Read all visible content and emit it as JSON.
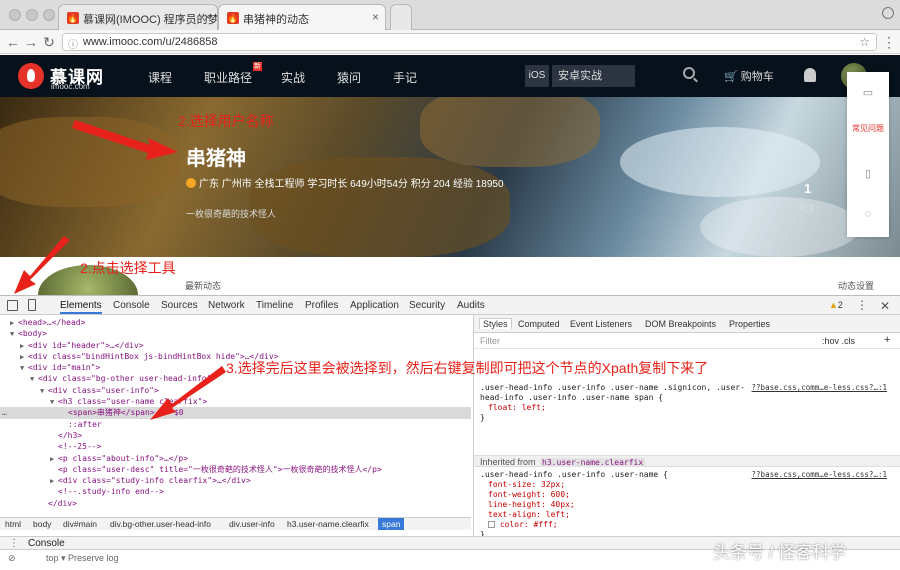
{
  "browser": {
    "tabs": [
      {
        "label": "慕课网(IMOOC) 程序员的梦工厂",
        "active": false
      },
      {
        "label": "串猪神的动态",
        "active": true
      }
    ],
    "url": "www.imooc.com/u/2486858"
  },
  "site_nav": {
    "logo_text": "慕课网",
    "logo_sub": "imooc.com",
    "links": [
      "课程",
      "职业路径",
      "实战",
      "猿问",
      "手记"
    ],
    "new_badge": "新",
    "search_tag": "iOS",
    "search_placeholder": "安卓实战",
    "cart_label": "购物车"
  },
  "profile": {
    "username": "串猪神",
    "meta": "广东 广州市 全栈工程师   学习时长 649小时54分   积分 204   经验 18950",
    "signature": "一枚很奇葩的技术怪人",
    "follow_count": "1",
    "follow_label": "关注",
    "recent_label": "最新动态",
    "settings_label": "动态设置"
  },
  "side_rail": {
    "items": [
      "常见问题"
    ]
  },
  "annotations": {
    "step2_name": "2.选择用户名称",
    "step2_tool": "2.点击选择工具",
    "step3": "3.选择完后这里会被选择到，然后右键复制即可把这个节点的Xpath复制下来了"
  },
  "devtools": {
    "tabs": [
      "Elements",
      "Console",
      "Sources",
      "Network",
      "Timeline",
      "Profiles",
      "Application",
      "Security",
      "Audits"
    ],
    "warnings": "2",
    "dom_lines": [
      {
        "indent": 0,
        "tri": "▶",
        "text": "<head>…</head>"
      },
      {
        "indent": 0,
        "tri": "▼",
        "text": "<body>"
      },
      {
        "indent": 1,
        "tri": "▶",
        "text": "<div id=\"header\">…</div>"
      },
      {
        "indent": 1,
        "tri": "▶",
        "text": "<div class=\"bindHintBox js-bindHintBox hide\">…</div>"
      },
      {
        "indent": 1,
        "tri": "▼",
        "text": "<div id=\"main\">"
      },
      {
        "indent": 2,
        "tri": "▼",
        "text": "<div class=\"bg-other user-head-info\">"
      },
      {
        "indent": 3,
        "tri": "▼",
        "text": "<div class=\"user-info\">"
      },
      {
        "indent": 4,
        "tri": "▼",
        "text": "<h3 class=\"user-name clearfix\">"
      },
      {
        "indent": 5,
        "tri": "",
        "text": "<span>串猪神</span> == $0",
        "selected": true
      },
      {
        "indent": 5,
        "tri": "",
        "text": "::after"
      },
      {
        "indent": 4,
        "tri": "",
        "text": "</h3>"
      },
      {
        "indent": 4,
        "tri": "",
        "text": "<!--25-->"
      },
      {
        "indent": 4,
        "tri": "▶",
        "text": "<p class=\"about-info\">…</p>"
      },
      {
        "indent": 4,
        "tri": "",
        "text": "<p class=\"user-desc\" title=\"一枚很奇葩的技术怪人\">一枚很奇葩的技术怪人</p>"
      },
      {
        "indent": 4,
        "tri": "▶",
        "text": "<div class=\"study-info clearfix\">…</div>"
      },
      {
        "indent": 4,
        "tri": "",
        "text": "<!--.study-info end-->"
      },
      {
        "indent": 3,
        "tri": "",
        "text": "</div>"
      }
    ],
    "breadcrumbs": [
      "html",
      "body",
      "div#main",
      "div.bg-other.user-head-info",
      "div.user-info",
      "h3.user-name.clearfix",
      "span"
    ],
    "styles_tabs": [
      "Styles",
      "Computed",
      "Event Listeners",
      "DOM Breakpoints",
      "Properties"
    ],
    "filter_placeholder": "Filter",
    "hov_cls": ":hov  .cls",
    "rule1_selector": ".user-head-info .user-info .user-name .signicon, .user-head-info .user-info .user-name span {",
    "rule1_source": "??base.css,comm…e-less.css?…:1",
    "rule1_prop": "float: left;",
    "inherited_label": "Inherited from",
    "inherited_node": "h3.user-name.clearfix",
    "rule2_selector": ".user-head-info .user-info .user-name {",
    "rule2_source": "??base.css,comm…e-less.css?…:1",
    "rule2_props": [
      "font-size: 32px;",
      "font-weight: 600;",
      "line-height: 40px;",
      "text-align: left;",
      "color: #fff;"
    ],
    "console_label": "Console",
    "console_row": "top  ▾   Preserve log"
  },
  "watermark": "头条号 / 怪客科学"
}
